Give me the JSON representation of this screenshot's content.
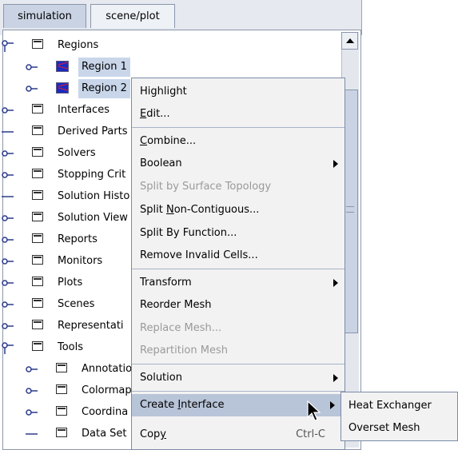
{
  "tabs": [
    {
      "label": "simulation",
      "active": true
    },
    {
      "label": "scene/plot",
      "active": false
    }
  ],
  "tree": [
    {
      "label": "Regions",
      "level": 0,
      "icon": "folder-icon",
      "handle": "expanded"
    },
    {
      "label": "Region 1",
      "level": 1,
      "icon": "region-icon",
      "handle": "collapsed",
      "selected": true
    },
    {
      "label": "Region 2",
      "level": 1,
      "icon": "region-icon",
      "handle": "collapsed",
      "selected": true
    },
    {
      "label": "Interfaces",
      "level": 0,
      "icon": "folder-icon",
      "handle": "collapsed"
    },
    {
      "label": "Derived Parts",
      "level": 0,
      "icon": "folder-icon",
      "handle": "leaf"
    },
    {
      "label": "Solvers",
      "level": 0,
      "icon": "folder-icon",
      "handle": "collapsed"
    },
    {
      "label": "Stopping Crit",
      "level": 0,
      "icon": "folder-icon",
      "handle": "collapsed"
    },
    {
      "label": "Solution Histo",
      "level": 0,
      "icon": "folder-icon",
      "handle": "leaf"
    },
    {
      "label": "Solution View",
      "level": 0,
      "icon": "folder-icon",
      "handle": "collapsed"
    },
    {
      "label": "Reports",
      "level": 0,
      "icon": "folder-icon",
      "handle": "collapsed"
    },
    {
      "label": "Monitors",
      "level": 0,
      "icon": "folder-icon",
      "handle": "collapsed"
    },
    {
      "label": "Plots",
      "level": 0,
      "icon": "folder-icon",
      "handle": "collapsed"
    },
    {
      "label": "Scenes",
      "level": 0,
      "icon": "folder-icon",
      "handle": "collapsed"
    },
    {
      "label": "Representati",
      "level": 0,
      "icon": "folder-icon",
      "handle": "collapsed"
    },
    {
      "label": "Tools",
      "level": 0,
      "icon": "folder-icon",
      "handle": "expanded"
    },
    {
      "label": "Annotatio",
      "level": 1,
      "icon": "folder-icon",
      "handle": "collapsed"
    },
    {
      "label": "Colormap",
      "level": 1,
      "icon": "folder-icon",
      "handle": "collapsed"
    },
    {
      "label": "Coordina",
      "level": 1,
      "icon": "folder-icon",
      "handle": "collapsed"
    },
    {
      "label": "Data Set",
      "level": 1,
      "icon": "folder-icon",
      "handle": "leaf"
    }
  ],
  "context_menu": [
    {
      "label": "Highlight",
      "mnemonic": "",
      "enabled": true
    },
    {
      "label": "dit...",
      "mnemonic": "E",
      "enabled": true
    },
    {
      "separator": true
    },
    {
      "label": "ombine...",
      "mnemonic": "C",
      "enabled": true
    },
    {
      "label": "Boolean",
      "mnemonic": "",
      "enabled": true,
      "submenu": true
    },
    {
      "label": "Split by Surface Topology",
      "mnemonic": "",
      "enabled": false
    },
    {
      "label": "Split Non-Contiguous...",
      "mnemonic": "",
      "enabled": true,
      "underline_char": "N"
    },
    {
      "label": "Split By Function...",
      "mnemonic": "",
      "enabled": true
    },
    {
      "label": "Remove Invalid Cells...",
      "mnemonic": "",
      "enabled": true
    },
    {
      "separator": true
    },
    {
      "label": "Transform",
      "mnemonic": "",
      "enabled": true,
      "submenu": true
    },
    {
      "label": "Reorder Mesh",
      "mnemonic": "",
      "enabled": true
    },
    {
      "label": "Replace Mesh...",
      "mnemonic": "",
      "enabled": false
    },
    {
      "label": "Repartition Mesh",
      "mnemonic": "",
      "enabled": false
    },
    {
      "separator": true
    },
    {
      "label": "Solution",
      "mnemonic": "",
      "enabled": true,
      "submenu": true
    },
    {
      "separator": true
    },
    {
      "label": "Create Interface",
      "mnemonic": "",
      "enabled": true,
      "submenu": true,
      "highlighted": true
    },
    {
      "label": "Copy",
      "mnemonic": "",
      "enabled": true,
      "accelerator": "Ctrl-C"
    }
  ],
  "menu_text": {
    "highlight": "Highlight",
    "edit_m": "E",
    "edit_rest": "dit...",
    "combine_m": "C",
    "combine_rest": "ombine...",
    "boolean": "Boolean",
    "split_topology": "Split by Surface Topology",
    "split_noncontig_a": "Split ",
    "split_noncontig_m": "N",
    "split_noncontig_b": "on-Contiguous...",
    "split_function": "Split By Function...",
    "remove_invalid": "Remove Invalid Cells...",
    "transform": "Transform",
    "reorder": "Reorder Mesh",
    "replace": "Replace Mesh...",
    "repartition": "Repartition Mesh",
    "solution": "Solution",
    "create_iface_a": "Create ",
    "create_iface_m": "I",
    "create_iface_b": "nterface",
    "copy_a": "Cop",
    "copy_m": "y",
    "copy_accel": "Ctrl-C"
  },
  "submenu": [
    {
      "label": "Heat Exchanger"
    },
    {
      "label": "Overset Mesh"
    }
  ],
  "colors": {
    "selection": "#c9d6ea",
    "menu_highlight": "#b8c4d8",
    "disabled": "#9a9a9a"
  }
}
